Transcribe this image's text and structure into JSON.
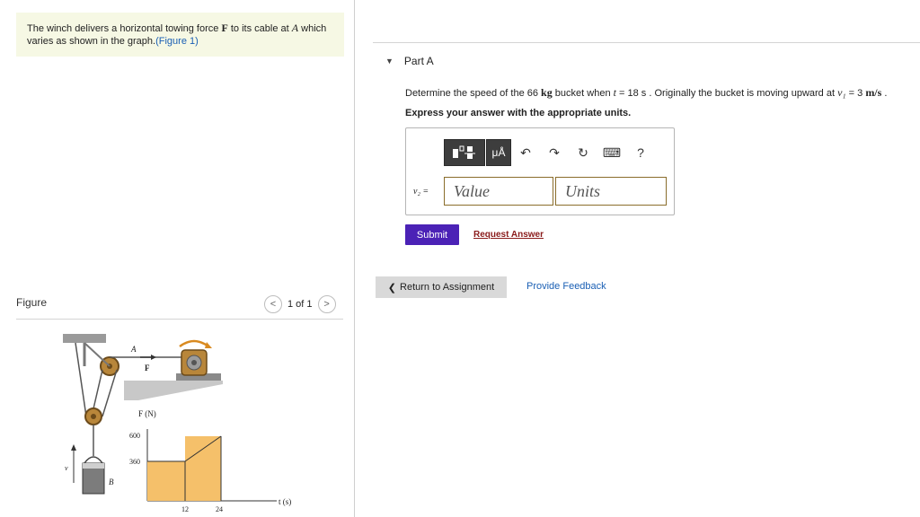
{
  "problem": {
    "text_part1": "The winch delivers a horizontal towing force",
    "force_symbol": "F",
    "text_part2": "to its cable at",
    "point_symbol": "A",
    "text_part3": "which varies as shown in the graph.",
    "figure_link": "(Figure 1)"
  },
  "figure_panel": {
    "label": "Figure",
    "pager_text": "1 of 1",
    "prev_icon": "chevron-left-icon",
    "next_icon": "chevron-right-icon"
  },
  "figure": {
    "label_A": "A",
    "label_F": "F",
    "label_B": "B",
    "label_v": "v",
    "graph_ylabel": "F (N)",
    "graph_xlabel": "t (s)",
    "ytick_600": "600",
    "ytick_360": "360",
    "xtick_12": "12",
    "xtick_24": "24",
    "fill_color": "#f5c06a"
  },
  "part": {
    "caret_icon": "triangle-down-icon",
    "title": "Part A"
  },
  "question": {
    "text1": "Determine the speed of the 66",
    "mass_unit": "kg",
    "text2": "bucket when",
    "t_symbol": "t",
    "text3": "= 18 s . Originally the bucket is moving upward at",
    "v1_symbol": "v₁",
    "text4": "= 3",
    "speed_unit": "m/s",
    "text5": "."
  },
  "instruction": "Express your answer with the appropriate units.",
  "toolbar": {
    "units_label": "μÅ",
    "undo_icon": "↶",
    "redo_icon": "↷",
    "reset_icon": "↻",
    "keyboard_icon": "⌨",
    "help_label": "?"
  },
  "answer": {
    "var_label": "v₂ =",
    "value_placeholder": "Value",
    "units_placeholder": "Units"
  },
  "actions": {
    "submit_label": "Submit",
    "request_label": "Request Answer"
  },
  "footer": {
    "return_label": "Return to Assignment",
    "feedback_label": "Provide Feedback"
  },
  "colors": {
    "submit": "#4b22b6",
    "problem_bg": "#f6f8e4",
    "link": "#1a5fb4"
  }
}
